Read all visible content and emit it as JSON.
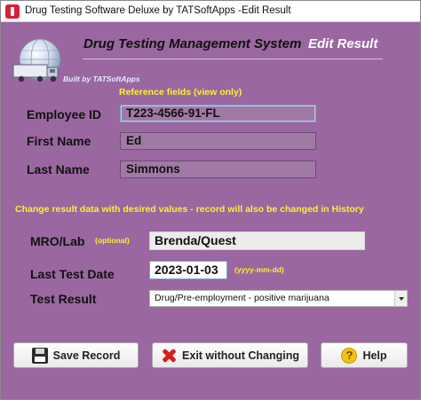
{
  "window": {
    "title": "Drug Testing Software Deluxe by TATSoftApps -Edit Result"
  },
  "header": {
    "title": "Drug Testing Management System",
    "subtitle": "Edit Result",
    "built_by": "Built by TATSoftApps",
    "logo_icon": "globe-truck-icon"
  },
  "reference": {
    "note": "Reference fields (view only)",
    "employee_id_label": "Employee ID",
    "employee_id": "T223-4566-91-FL",
    "first_name_label": "First Name",
    "first_name": "Ed",
    "last_name_label": "Last Name",
    "last_name": "Simmons"
  },
  "edit": {
    "note": "Change result data with desired values - record will also be changed in History",
    "mro_label": "MRO/Lab",
    "mro_optional": "(optional)",
    "mro_value": "Brenda/Quest",
    "last_test_label": "Last Test Date",
    "last_test_value": "2023-01-03",
    "date_hint": "(yyyy-mm-dd)",
    "test_result_label": "Test Result",
    "test_result_value": "Drug/Pre-employment - positive marijuana"
  },
  "buttons": {
    "save": "Save Record",
    "exit": "Exit without Changing",
    "help": "Help"
  },
  "colors": {
    "background": "#9a67a0",
    "note_yellow": "#ffee33",
    "exit_icon": "#d81e1e",
    "help_icon": "#f4c20d"
  }
}
